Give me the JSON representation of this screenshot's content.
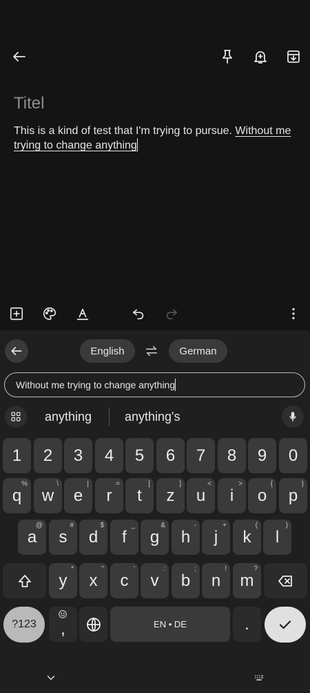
{
  "note": {
    "title_placeholder": "Titel",
    "body_text": "This is a kind of test that I'm trying to pursue. ",
    "body_composing": "Without me trying to change anything"
  },
  "topbar": {
    "back_icon": "arrow-left-icon",
    "pin_icon": "pin-icon",
    "reminder_icon": "bell-plus-icon",
    "archive_icon": "archive-icon"
  },
  "note_toolbar": {
    "add_icon": "add-box-icon",
    "palette_icon": "palette-icon",
    "text_format_icon": "text-format-icon",
    "undo_icon": "undo-icon",
    "redo_icon": "redo-icon",
    "more_icon": "more-vert-icon"
  },
  "keyboard": {
    "translate": {
      "source_language": "English",
      "target_language": "German",
      "input_value": "Without me trying to change anything"
    },
    "suggestions": [
      "anything",
      "anything's"
    ],
    "number_row": [
      "1",
      "2",
      "3",
      "4",
      "5",
      "6",
      "7",
      "8",
      "9",
      "0"
    ],
    "row1": [
      {
        "key": "q",
        "hint": "%"
      },
      {
        "key": "w",
        "hint": "\\"
      },
      {
        "key": "e",
        "hint": "|"
      },
      {
        "key": "r",
        "hint": "="
      },
      {
        "key": "t",
        "hint": "["
      },
      {
        "key": "z",
        "hint": "]"
      },
      {
        "key": "u",
        "hint": "<"
      },
      {
        "key": "i",
        "hint": ">"
      },
      {
        "key": "o",
        "hint": "{"
      },
      {
        "key": "p",
        "hint": "}"
      }
    ],
    "row2": [
      {
        "key": "a",
        "hint": "@"
      },
      {
        "key": "s",
        "hint": "#"
      },
      {
        "key": "d",
        "hint": "$"
      },
      {
        "key": "f",
        "hint": "_"
      },
      {
        "key": "g",
        "hint": "&"
      },
      {
        "key": "h",
        "hint": "-"
      },
      {
        "key": "j",
        "hint": "+"
      },
      {
        "key": "k",
        "hint": "("
      },
      {
        "key": "l",
        "hint": ")"
      }
    ],
    "row3": [
      {
        "key": "y",
        "hint": "*"
      },
      {
        "key": "x",
        "hint": "\""
      },
      {
        "key": "c",
        "hint": "'"
      },
      {
        "key": "v",
        "hint": ":"
      },
      {
        "key": "b",
        "hint": ";"
      },
      {
        "key": "n",
        "hint": "!"
      },
      {
        "key": "m",
        "hint": "?"
      }
    ],
    "symbols_label": "?123",
    "comma_label": ",",
    "space_label": "EN • DE",
    "period_label": ".",
    "accent_colors": {
      "enter_key": "#e0e0e0",
      "symbols_key": "#b9b9b9"
    }
  }
}
